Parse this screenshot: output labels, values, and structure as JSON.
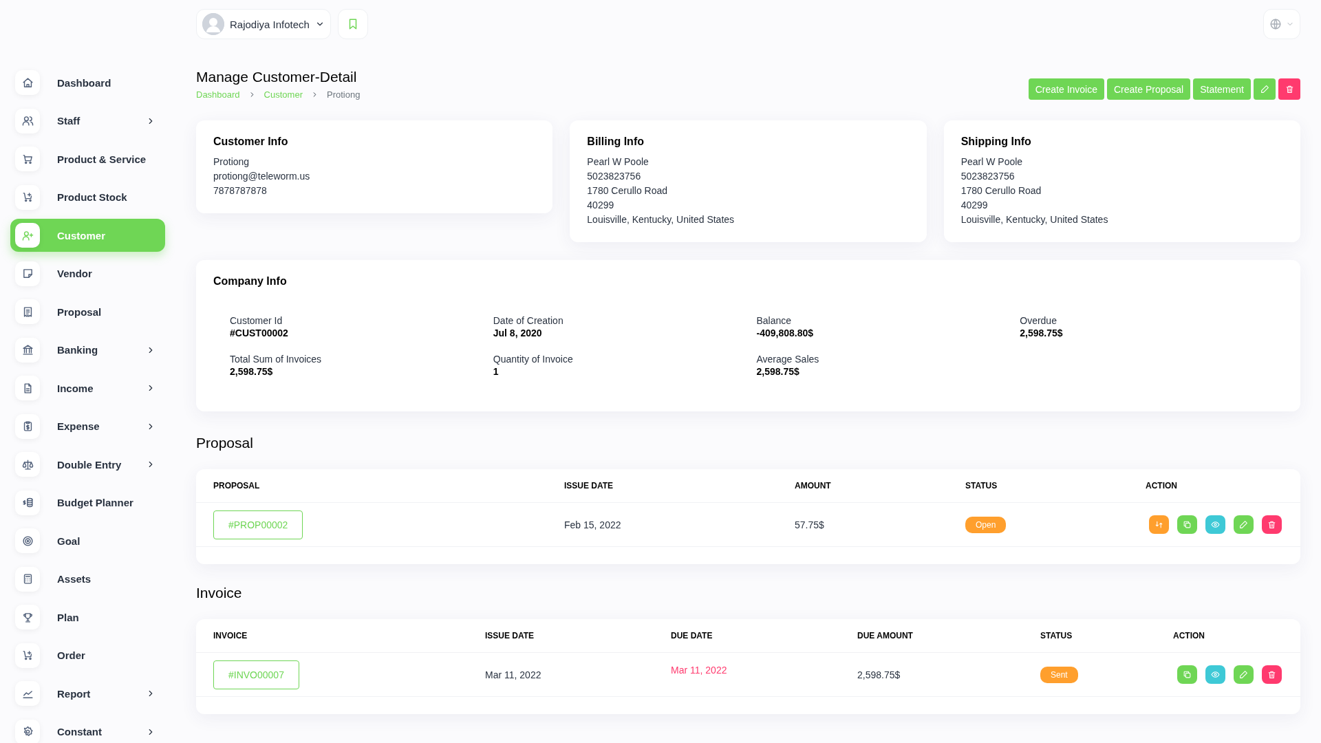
{
  "topbar": {
    "company": "Rajodiya Infotech"
  },
  "sidebar": {
    "items": [
      {
        "label": "Dashboard",
        "selected": false,
        "has_submenu": false
      },
      {
        "label": "Staff",
        "selected": false,
        "has_submenu": true
      },
      {
        "label": "Product & Service",
        "selected": false,
        "has_submenu": false
      },
      {
        "label": "Product Stock",
        "selected": false,
        "has_submenu": false
      },
      {
        "label": "Customer",
        "selected": true,
        "has_submenu": false
      },
      {
        "label": "Vendor",
        "selected": false,
        "has_submenu": false
      },
      {
        "label": "Proposal",
        "selected": false,
        "has_submenu": false
      },
      {
        "label": "Banking",
        "selected": false,
        "has_submenu": true
      },
      {
        "label": "Income",
        "selected": false,
        "has_submenu": true
      },
      {
        "label": "Expense",
        "selected": false,
        "has_submenu": true
      },
      {
        "label": "Double Entry",
        "selected": false,
        "has_submenu": true
      },
      {
        "label": "Budget Planner",
        "selected": false,
        "has_submenu": false
      },
      {
        "label": "Goal",
        "selected": false,
        "has_submenu": false
      },
      {
        "label": "Assets",
        "selected": false,
        "has_submenu": false
      },
      {
        "label": "Plan",
        "selected": false,
        "has_submenu": false
      },
      {
        "label": "Order",
        "selected": false,
        "has_submenu": false
      },
      {
        "label": "Report",
        "selected": false,
        "has_submenu": true
      },
      {
        "label": "Constant",
        "selected": false,
        "has_submenu": true
      }
    ]
  },
  "page": {
    "title": "Manage Customer-Detail",
    "breadcrumb": [
      {
        "label": "Dashboard",
        "link": true
      },
      {
        "label": "Customer",
        "link": true
      },
      {
        "label": "Protiong",
        "link": false
      }
    ],
    "actions": [
      {
        "kind": "text",
        "label": "Create Invoice"
      },
      {
        "kind": "text",
        "label": "Create Proposal"
      },
      {
        "kind": "text",
        "label": "Statement"
      },
      {
        "kind": "edit"
      },
      {
        "kind": "delete"
      }
    ]
  },
  "info_cards": [
    {
      "title": "Customer Info",
      "lines": [
        "Protiong",
        "protiong@teleworm.us",
        "7878787878"
      ]
    },
    {
      "title": "Billing Info",
      "lines": [
        "Pearl W Poole",
        "5023823756",
        "1780 Cerullo Road",
        "40299",
        "Louisville, Kentucky, United States"
      ]
    },
    {
      "title": "Shipping Info",
      "lines": [
        "Pearl W Poole",
        "5023823756",
        "1780 Cerullo Road",
        "40299",
        "Louisville, Kentucky, United States"
      ]
    }
  ],
  "company_info": {
    "title": "Company Info",
    "fields": [
      {
        "label": "Customer Id",
        "value": "#CUST00002"
      },
      {
        "label": "Date of Creation",
        "value": "Jul 8, 2020"
      },
      {
        "label": "Balance",
        "value": "-409,808.80$"
      },
      {
        "label": "Overdue",
        "value": "2,598.75$"
      },
      {
        "label": "Total Sum of Invoices",
        "value": "2,598.75$"
      },
      {
        "label": "Quantity of Invoice",
        "value": "1"
      },
      {
        "label": "Average Sales",
        "value": "2,598.75$"
      }
    ]
  },
  "proposal": {
    "title": "Proposal",
    "columns": [
      "PROPOSAL",
      "ISSUE DATE",
      "AMOUNT",
      "STATUS",
      "ACTION"
    ],
    "rows": [
      {
        "number": "#PROP00002",
        "issue_date": "Feb 15, 2022",
        "amount": "57.75$",
        "status": "Open",
        "actions": [
          {
            "kind": "convert"
          },
          {
            "kind": "copy"
          },
          {
            "kind": "view"
          },
          {
            "kind": "edit"
          },
          {
            "kind": "delete"
          }
        ]
      }
    ]
  },
  "invoice": {
    "title": "Invoice",
    "columns": [
      "INVOICE",
      "ISSUE DATE",
      "DUE DATE",
      "DUE AMOUNT",
      "STATUS",
      "ACTION"
    ],
    "rows": [
      {
        "number": "#INVO00007",
        "issue_date": "Mar 11, 2022",
        "due_date": "Mar 11, 2022",
        "overdue": true,
        "due_amount": "2,598.75$",
        "status": "Sent",
        "actions": [
          {
            "kind": "copy"
          },
          {
            "kind": "view"
          },
          {
            "kind": "edit"
          },
          {
            "kind": "delete"
          }
        ]
      }
    ]
  }
}
